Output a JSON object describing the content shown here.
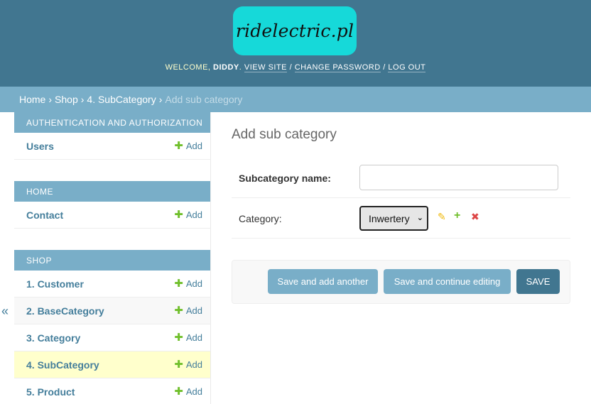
{
  "header": {
    "logo_text": "ridelectric.pl",
    "welcome": "WELCOME,",
    "username": "DIDDY",
    "view_site": "VIEW SITE",
    "change_password": "CHANGE PASSWORD",
    "log_out": "LOG OUT"
  },
  "breadcrumbs": {
    "home": "Home",
    "shop": "Shop",
    "subcategory": "4. SubCategory",
    "current": "Add sub category"
  },
  "sidebar": {
    "toggle": "«",
    "add_label": "Add",
    "modules": [
      {
        "caption": "Authentication and Authorization",
        "models": [
          {
            "name": "Users"
          }
        ]
      },
      {
        "caption": "Home",
        "models": [
          {
            "name": "Contact"
          }
        ]
      },
      {
        "caption": "Shop",
        "models": [
          {
            "name": "1. Customer"
          },
          {
            "name": "2. BaseCategory"
          },
          {
            "name": "3. Category"
          },
          {
            "name": "4. SubCategory"
          },
          {
            "name": "5. Product"
          }
        ]
      }
    ]
  },
  "content": {
    "title": "Add sub category",
    "subcategory_label": "Subcategory name:",
    "subcategory_value": "",
    "category_label": "Category:",
    "category_selected": "Inwertery"
  },
  "submit": {
    "save_add_another": "Save and add another",
    "save_continue": "Save and continue editing",
    "save": "SAVE"
  },
  "colors": {
    "header_bg": "#417690",
    "breadcrumb_bg": "#79aec8",
    "logo_bg": "#16d9d9",
    "link": "#447e9b",
    "add_plus": "#70bf2b",
    "active_row": "#ffffcc"
  }
}
